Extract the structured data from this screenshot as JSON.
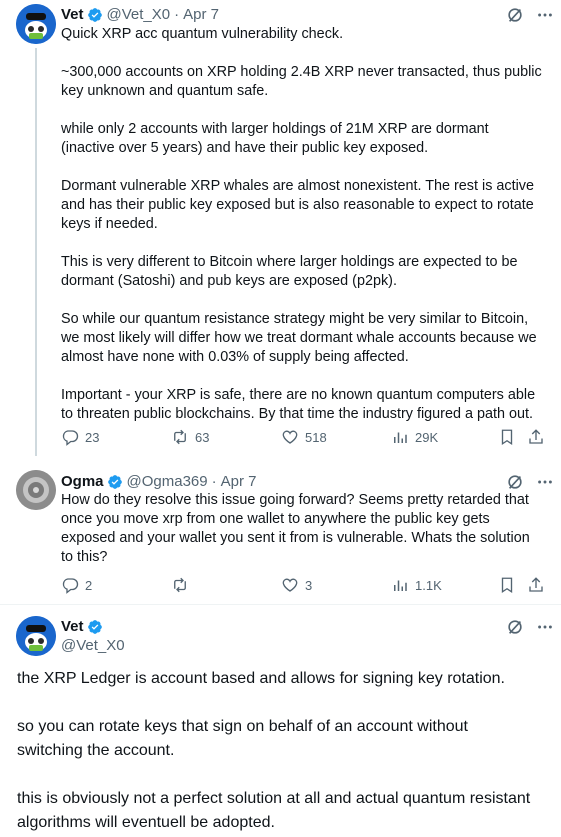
{
  "tweet1": {
    "name": "Vet",
    "handle": "@Vet_X0",
    "dot": "·",
    "date": "Apr 7",
    "paragraphs": [
      "Quick XRP acc quantum vulnerability check.",
      "~300,000 accounts on XRP holding 2.4B XRP never transacted, thus public key unknown and quantum safe.",
      "while only 2 accounts with larger holdings of 21M XRP are dormant (inactive over 5 years) and have their public key exposed.",
      "Dormant vulnerable XRP whales are almost nonexistent. The rest is active and has their public key exposed but is also reasonable to expect to rotate keys if needed.",
      "This is very different to Bitcoin where larger holdings are expected to be dormant (Satoshi) and pub keys are exposed (p2pk).",
      "So while our quantum resistance strategy might be very similar to Bitcoin, we most likely will differ how we treat dormant whale accounts because we almost have none with 0.03% of supply being affected.",
      "Important - your XRP is safe, there are no known quantum computers able to threaten public blockchains. By that time the industry figured a path out."
    ],
    "replies": "23",
    "reposts": "63",
    "likes": "518",
    "views": "29K"
  },
  "tweet2": {
    "name": "Ogma",
    "handle": "@Ogma369",
    "dot": "·",
    "date": "Apr 7",
    "text": "How do they resolve this issue going forward? Seems pretty retarded that once you move xrp from one wallet to anywhere the public key gets exposed and your wallet you sent it from is vulnerable. Whats the solution to this?",
    "replies": "2",
    "reposts": "",
    "likes": "3",
    "views": "1.1K"
  },
  "tweet3": {
    "name": "Vet",
    "handle": "@Vet_X0",
    "paragraphs": [
      "the XRP Ledger is account based and allows for signing key rotation.",
      "so you can rotate keys that sign on behalf of an account without switching the account.",
      "this is obviously not a perfect solution at all and actual quantum resistant algorithms will eventuell be adopted."
    ]
  },
  "colors": {
    "verified": "#1d9bf0",
    "muted": "#536471",
    "text": "#0f1419",
    "thread_line": "#cfd9de"
  },
  "icons": [
    "grok-icon",
    "more-icon",
    "reply-icon",
    "repost-icon",
    "like-icon",
    "views-icon",
    "bookmark-icon",
    "share-icon",
    "verified-badge-icon"
  ]
}
